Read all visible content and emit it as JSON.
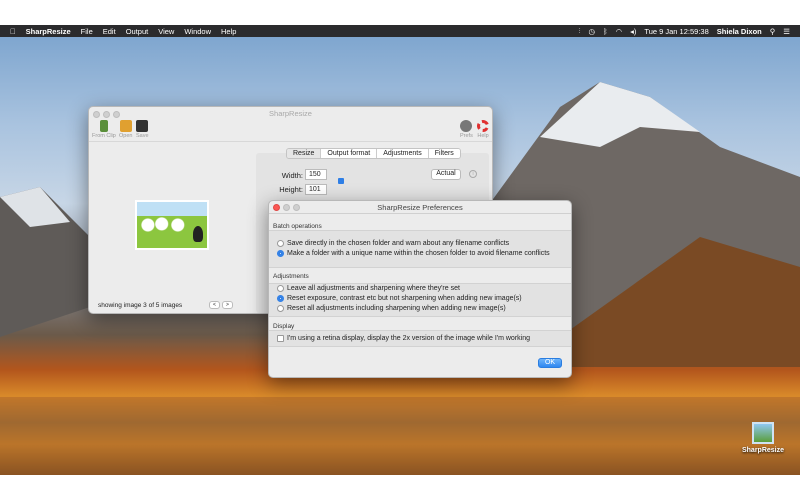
{
  "menubar": {
    "app": "SharpResize",
    "items": [
      "File",
      "Edit",
      "Output",
      "View",
      "Window",
      "Help"
    ],
    "clock": "Tue 9 Jan  12:59:38",
    "user": "Shiela Dixon"
  },
  "main_window": {
    "title": "SharpResize",
    "toolbar": {
      "from_clip": "From Clip",
      "open": "Open",
      "save": "Save",
      "prefs": "Prefs",
      "help": "Help"
    },
    "tabs": [
      "Resize",
      "Output format",
      "Adjustments",
      "Filters"
    ],
    "active_tab": "Resize",
    "width_label": "Width:",
    "width_value": "150",
    "height_label": "Height:",
    "height_value": "101",
    "actual_button": "Actual",
    "status": "showing image 3 of 5 images",
    "prev": "<",
    "next": ">"
  },
  "prefs": {
    "title": "SharpResize Preferences",
    "batch": {
      "heading": "Batch operations",
      "options": [
        "Save directly in the chosen folder and warn about any filename conflicts",
        "Make a folder with a unique name within the chosen folder to avoid filename conflicts"
      ],
      "selected": 1
    },
    "adjustments": {
      "heading": "Adjustments",
      "options": [
        "Leave all adjustments and sharpening where they're set",
        "Reset exposure, contrast etc but not sharpening when adding new image(s)",
        "Reset all adjustments including sharpening when adding new image(s)"
      ],
      "selected": 1
    },
    "display": {
      "heading": "Display",
      "checkbox": "I'm using a retina display, display the 2x version of the image while I'm working",
      "checked": false
    },
    "ok": "OK"
  },
  "desktop": {
    "icon_label": "SharpResize"
  }
}
